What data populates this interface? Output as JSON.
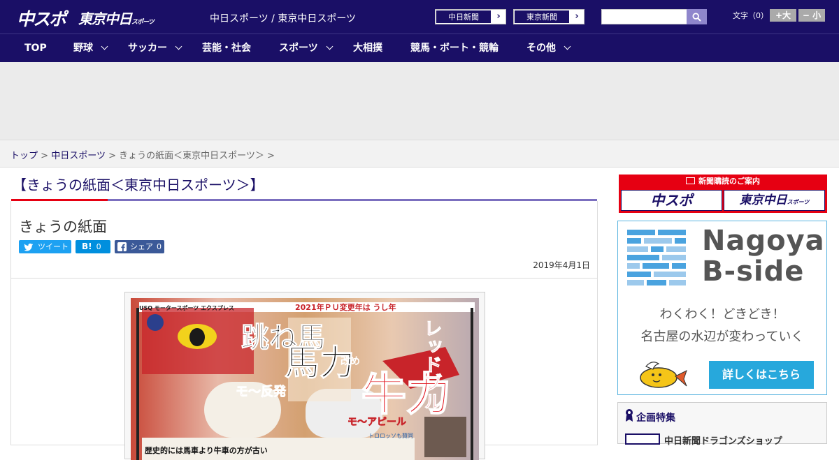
{
  "header": {
    "logo_chuspo": "中スポ",
    "logo_tokyo": "東京中日",
    "logo_tokyo_small": "スポーツ",
    "site_names": "中日スポーツ / 東京中日スポーツ",
    "chunichi_link": "中日新聞",
    "tokyo_link": "東京新聞",
    "search_placeholder": "",
    "fontsize_label": "文字（0）",
    "fontsize_larger": "+大",
    "fontsize_smaller": "− 小"
  },
  "nav": [
    {
      "label": "TOP"
    },
    {
      "label": "野球"
    },
    {
      "label": "サッカー"
    },
    {
      "label": "芸能・社会"
    },
    {
      "label": "スポーツ"
    },
    {
      "label": "大相撲"
    },
    {
      "label": "競馬・ボート・競輪"
    },
    {
      "label": "その他"
    }
  ],
  "breadcrumb": {
    "home": "トップ",
    "sep1": ">",
    "section": "中日スポーツ",
    "sep2": ">",
    "current": "きょうの紙面＜東京中日スポーツ＞",
    "sep3": ">"
  },
  "page_title": "【きょうの紙面＜東京中日スポーツ＞】",
  "article": {
    "title": "きょうの紙面",
    "tweet_label": "ツイート",
    "hatena_label": "B!",
    "hatena_count": "0",
    "share_label": "シェア",
    "share_count": "0",
    "date": "2019年4月1日"
  },
  "newspaper": {
    "masthead": "USQ モータースポーツ エクスプレス",
    "banner": "2021年ＰＵ変更年は うし年",
    "headline_left": "跳ね馬",
    "headline_center": "馬力",
    "headline_right": "牛力",
    "kaime": "改め",
    "vertical_right": "レッドブル",
    "sub_left": "モ〜反発",
    "sub_right": "モ〜アピール",
    "footer": "歴史的には馬車より牛車の方が古い",
    "footer_right": "トロロッソも賛同"
  },
  "sidebar": {
    "subscribe_title": "新聞購読のご案内",
    "subscribe_chuspo": "中スポ",
    "subscribe_tokyo": "東京中日",
    "subscribe_tokyo_small": "スポーツ",
    "bside_title_line1": "Nagoya",
    "bside_title_line2": "B-side",
    "bside_copy1": "わくわく！どきどき！",
    "bside_copy2": "名古屋の水辺が変わっていく",
    "bside_button": "詳しくはこちら",
    "feature_heading": "企画特集",
    "feature_item": "中日新聞ドラゴンズショップ"
  },
  "colors": {
    "brand_navy": "#1a0f66",
    "accent_red": "#e60012",
    "bside_blue": "#27a8dc"
  }
}
